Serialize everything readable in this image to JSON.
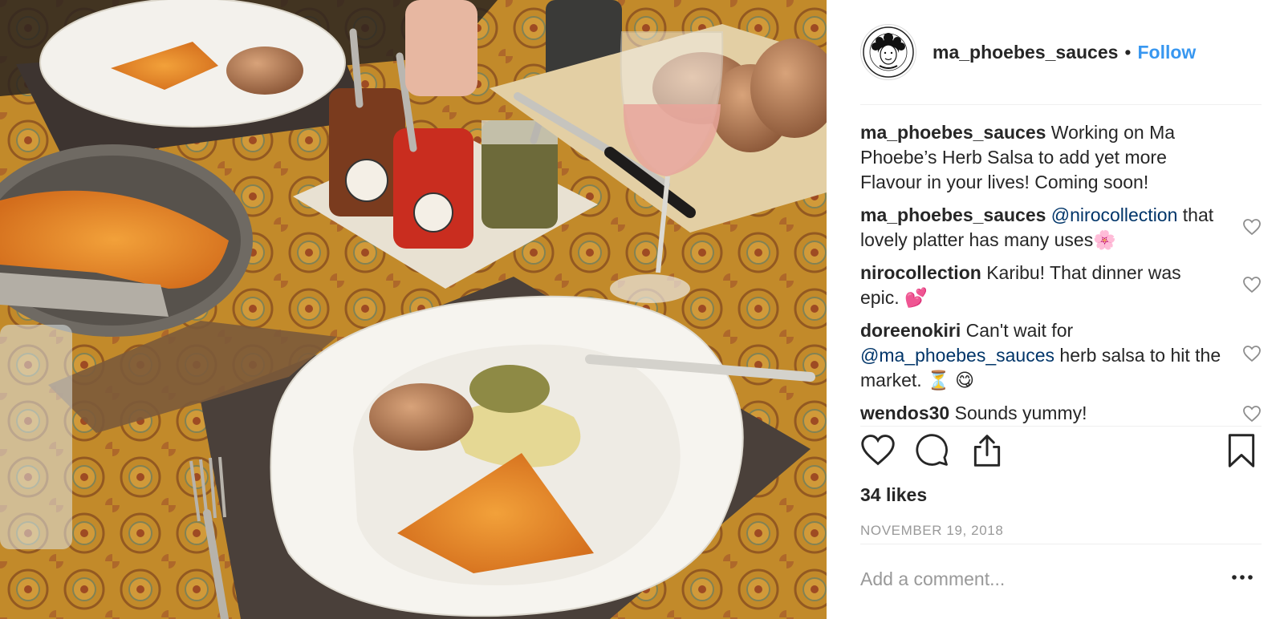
{
  "post": {
    "username": "ma_phoebes_sauces",
    "separator": "•",
    "follow_label": "Follow",
    "likes": "34 likes",
    "date": "NOVEMBER 19, 2018",
    "add_comment_placeholder": "Add a comment...",
    "more_label": "..."
  },
  "comments": [
    {
      "user": "ma_phoebes_sauces",
      "text": "Working on Ma Phoebe’s Herb Salsa to add yet more Flavour in your lives! Coming soon!"
    },
    {
      "user": "ma_phoebes_sauces",
      "mention": "@nirocollection",
      "text": "that lovely platter has many uses🌸"
    },
    {
      "user": "nirocollection",
      "text": "Karibu! That dinner was epic. 💕"
    },
    {
      "user": "doreenokiri",
      "text_before": "Can't wait for",
      "mention": "@ma_phoebes_sauces",
      "text_after": "herb salsa to hit the market. ⏳ 😋"
    },
    {
      "user": "wendos30",
      "text": "Sounds yummy!"
    }
  ],
  "avatar_logo_text": "MA PHOEBE'S SAUCES",
  "icons": {
    "like": "heart-icon",
    "comment": "comment-bubble-icon",
    "share": "share-icon",
    "save": "bookmark-icon",
    "comment_like": "heart-icon",
    "more": "more-options-icon"
  },
  "colors": {
    "follow": "#3897f0",
    "mention": "#003569",
    "muted": "#999999",
    "text": "#262626",
    "divider": "#efefef"
  }
}
